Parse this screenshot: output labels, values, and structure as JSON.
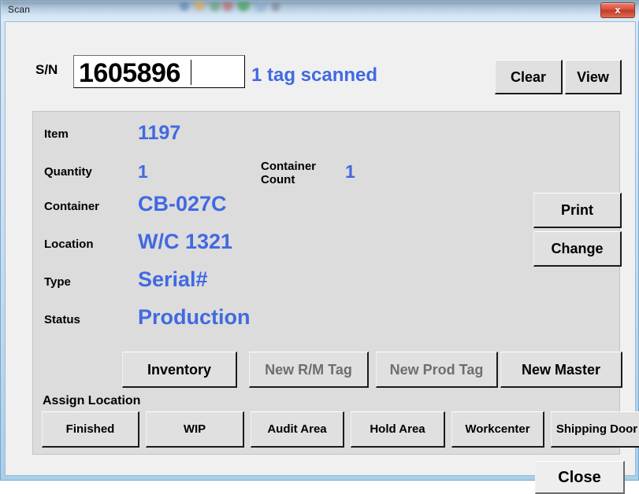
{
  "window": {
    "title": "Scan",
    "close_glyph": "x"
  },
  "colors": {
    "value_blue": "#4169E1",
    "panel_gray": "#DCDCDC",
    "client_gray": "#F0F0F0",
    "disabled_text": "#6E6E6E",
    "close_button_red": "#D9503A"
  },
  "scan_bar": {
    "sn_label": "S/N",
    "sn_value": "1605896",
    "sn_placeholder": "",
    "status_text": "1 tag scanned",
    "clear_label": "Clear",
    "view_label": "View"
  },
  "details": {
    "fields": [
      {
        "label": "Item",
        "value": "1197"
      },
      {
        "label": "Quantity",
        "value": "1"
      },
      {
        "label": "Container Count",
        "value": "1"
      },
      {
        "label": "Container",
        "value": "CB-027C"
      },
      {
        "label": "Location",
        "value": "W/C 1321"
      },
      {
        "label": "Type",
        "value": "Serial#"
      },
      {
        "label": "Status",
        "value": "Production"
      }
    ],
    "container_count_label_line1": "Container",
    "container_count_label_line2": "Count",
    "print_label": "Print",
    "change_label": "Change"
  },
  "actions": {
    "buttons": [
      {
        "label": "Inventory",
        "enabled": true
      },
      {
        "label": "New R/M Tag",
        "enabled": false
      },
      {
        "label": "New Prod Tag",
        "enabled": false
      },
      {
        "label": "New Master",
        "enabled": true
      }
    ]
  },
  "assign_location": {
    "section_label": "Assign Location",
    "buttons": [
      {
        "label": "Finished"
      },
      {
        "label": "WIP"
      },
      {
        "label": "Audit Area"
      },
      {
        "label": "Hold Area"
      },
      {
        "label": "Workcenter"
      },
      {
        "label": "Shipping Door"
      }
    ]
  },
  "footer": {
    "close_label": "Close"
  }
}
